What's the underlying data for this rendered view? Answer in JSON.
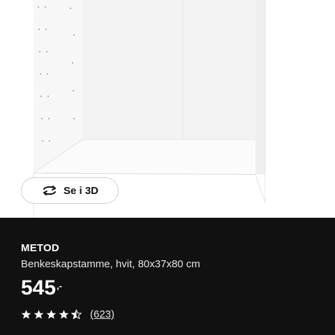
{
  "view3d": {
    "label": "Se i 3D",
    "icon": "rotate-3d-icon"
  },
  "product": {
    "name": "METOD",
    "description": "Benkeskapstamme, hvit, 80x37x80 cm",
    "price": {
      "integer": "545",
      "suffix": ",-"
    },
    "rating": {
      "value": 4.5,
      "max": 5,
      "reviews_label": "(623)"
    }
  },
  "colors": {
    "panel": "#111111",
    "text": "#ffffff",
    "cabinet": "#ffffff"
  }
}
